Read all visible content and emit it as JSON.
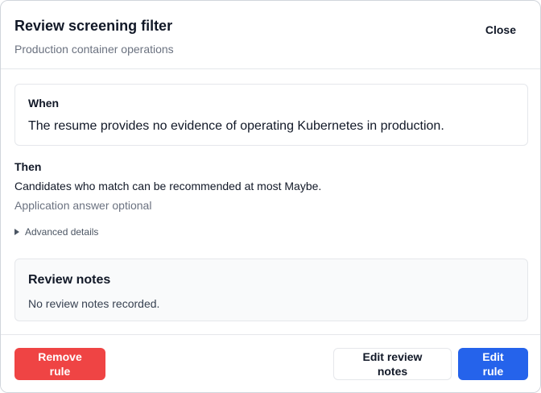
{
  "dialog": {
    "title": "Review screening filter",
    "subtitle": "Production container operations",
    "close_label": "Close"
  },
  "when": {
    "label": "When",
    "text": "The resume provides no evidence of operating Kubernetes in production."
  },
  "then": {
    "label": "Then",
    "text": "Candidates who match can be recommended at most Maybe.",
    "sub": "Application answer optional"
  },
  "advanced": {
    "label": "Advanced details"
  },
  "notes": {
    "title": "Review notes",
    "text": "No review notes recorded."
  },
  "footer": {
    "remove_label": "Remove rule",
    "edit_notes_label": "Edit review notes",
    "edit_rule_label": "Edit rule"
  },
  "colors": {
    "danger": "#ef4444",
    "primary": "#2563eb",
    "muted_text": "#6b7280",
    "panel_bg": "#f9fafb"
  },
  "icons": {
    "advanced_toggle": "triangle-right-icon"
  }
}
